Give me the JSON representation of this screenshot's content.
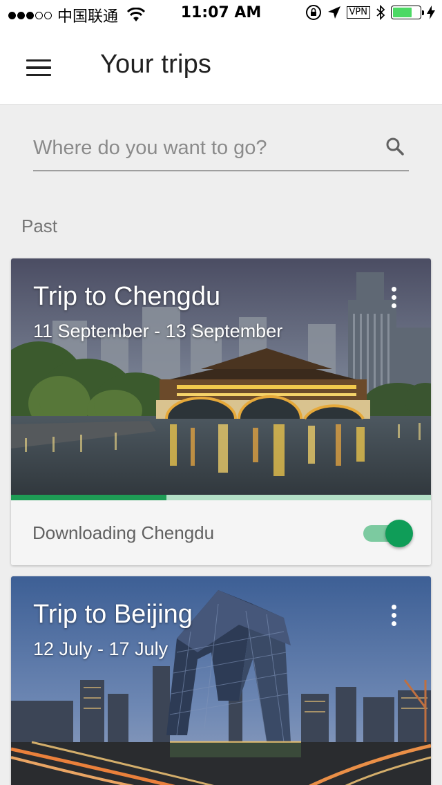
{
  "status_bar": {
    "carrier": "中国联通",
    "time": "11:07 AM",
    "vpn": "VPN"
  },
  "header": {
    "title": "Your trips",
    "menu_icon": "hamburger-menu-icon"
  },
  "search": {
    "placeholder": "Where do you want to go?",
    "value": "",
    "icon": "search-icon"
  },
  "section": {
    "label": "Past"
  },
  "trips": [
    {
      "title": "Trip to Chengdu",
      "dates": "11 September - 13 September",
      "download_label": "Downloading Chengdu",
      "download_progress": 0.37,
      "offline_toggle_on": true
    },
    {
      "title": "Trip to Beijing",
      "dates": "12 July - 17 July"
    }
  ],
  "colors": {
    "accent": "#0f9d58",
    "progress_track": "#b3dfc6",
    "toggle_track": "#7ccaa0",
    "background": "#eeeeee"
  }
}
